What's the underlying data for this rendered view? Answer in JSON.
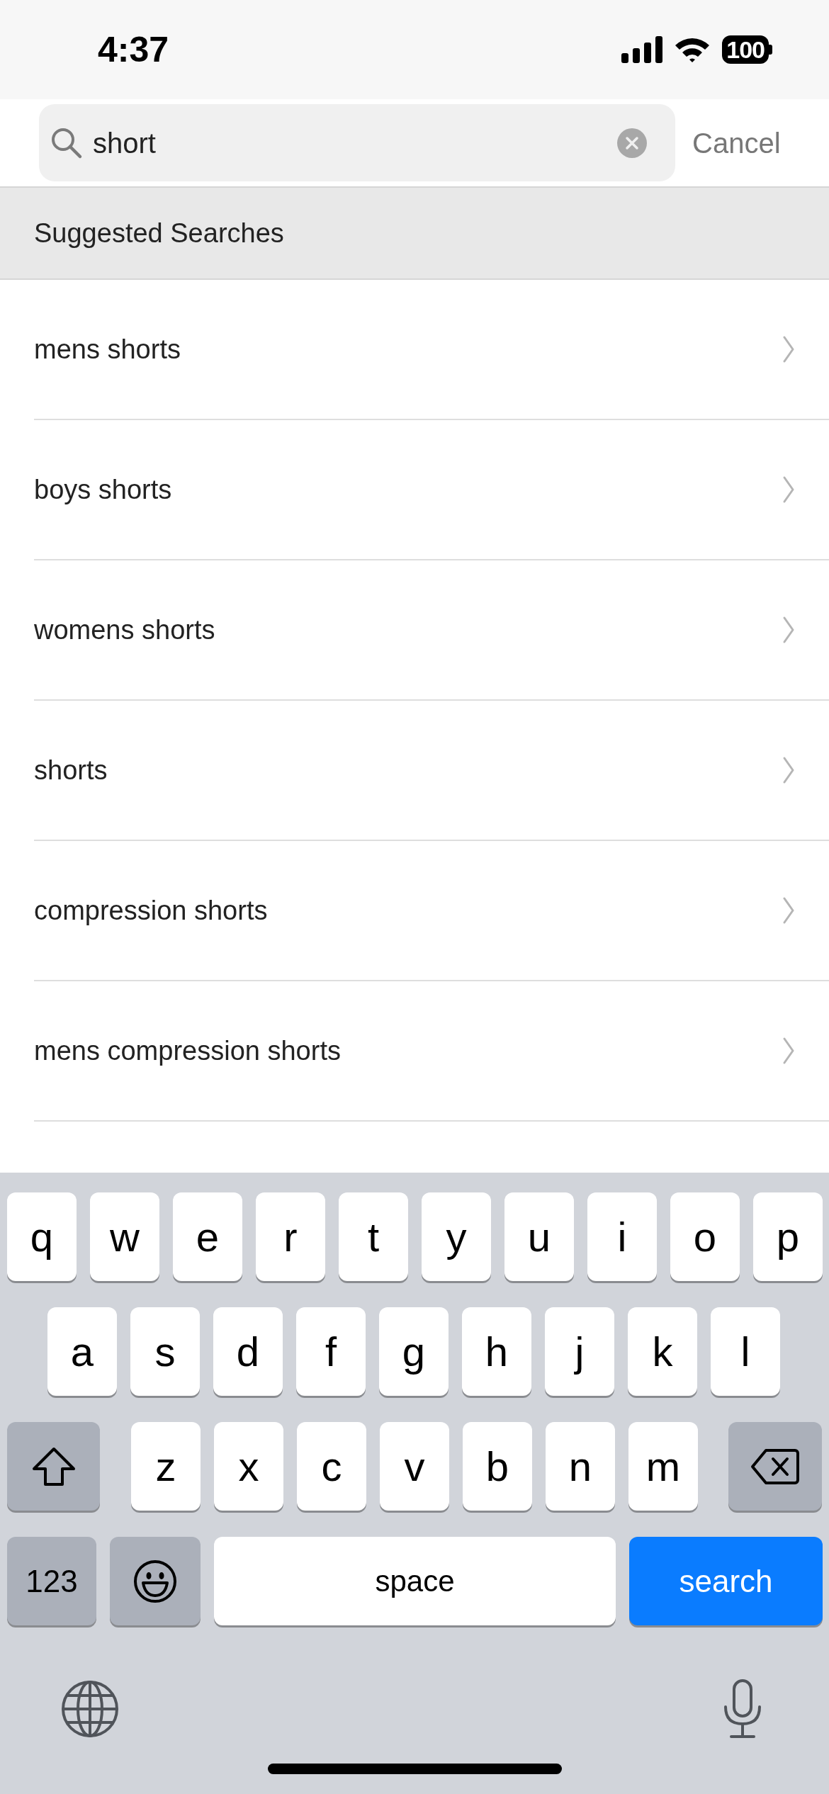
{
  "status_bar": {
    "time": "4:37",
    "battery": "100"
  },
  "search": {
    "value": "short",
    "cancel": "Cancel"
  },
  "section": {
    "title": "Suggested Searches"
  },
  "suggestions": [
    "mens shorts",
    "boys shorts",
    "womens shorts",
    "shorts",
    "compression shorts",
    "mens compression shorts"
  ],
  "keyboard": {
    "rows": [
      [
        {
          "kind": "letter",
          "label": "q"
        },
        {
          "kind": "letter",
          "label": "w"
        },
        {
          "kind": "letter",
          "label": "e"
        },
        {
          "kind": "letter",
          "label": "r"
        },
        {
          "kind": "letter",
          "label": "t"
        },
        {
          "kind": "letter",
          "label": "y"
        },
        {
          "kind": "letter",
          "label": "u"
        },
        {
          "kind": "letter",
          "label": "i"
        },
        {
          "kind": "letter",
          "label": "o"
        },
        {
          "kind": "letter",
          "label": "p"
        }
      ],
      [
        {
          "kind": "letter",
          "label": "a"
        },
        {
          "kind": "letter",
          "label": "s"
        },
        {
          "kind": "letter",
          "label": "d"
        },
        {
          "kind": "letter",
          "label": "f"
        },
        {
          "kind": "letter",
          "label": "g"
        },
        {
          "kind": "letter",
          "label": "h"
        },
        {
          "kind": "letter",
          "label": "j"
        },
        {
          "kind": "letter",
          "label": "k"
        },
        {
          "kind": "letter",
          "label": "l"
        }
      ],
      [
        {
          "kind": "shift"
        },
        {
          "kind": "letter",
          "label": "z"
        },
        {
          "kind": "letter",
          "label": "x"
        },
        {
          "kind": "letter",
          "label": "c"
        },
        {
          "kind": "letter",
          "label": "v"
        },
        {
          "kind": "letter",
          "label": "b"
        },
        {
          "kind": "letter",
          "label": "n"
        },
        {
          "kind": "letter",
          "label": "m"
        },
        {
          "kind": "delete"
        }
      ]
    ],
    "bottom_row": [
      {
        "kind": "mode",
        "label": "123"
      },
      {
        "kind": "emoji"
      },
      {
        "kind": "space",
        "label": "space"
      },
      {
        "kind": "action",
        "label": "search"
      }
    ]
  }
}
